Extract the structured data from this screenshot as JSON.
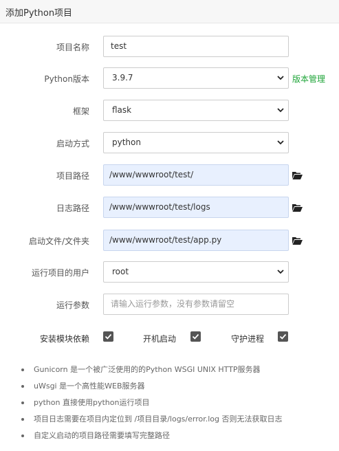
{
  "dialog": {
    "title": "添加Python项目"
  },
  "form": {
    "name": {
      "label": "项目名称",
      "value": "test"
    },
    "version": {
      "label": "Python版本",
      "value": "3.9.7",
      "link": "版本管理"
    },
    "framework": {
      "label": "框架",
      "value": "flask"
    },
    "start_method": {
      "label": "启动方式",
      "value": "python"
    },
    "project_path": {
      "label": "项目路径",
      "value": "/www/wwwroot/test/"
    },
    "log_path": {
      "label": "日志路径",
      "value": "/www/wwwroot/test/logs"
    },
    "start_file": {
      "label": "启动文件/文件夹",
      "value": "/www/wwwroot/test/app.py"
    },
    "run_user": {
      "label": "运行项目的用户",
      "value": "root"
    },
    "run_args": {
      "label": "运行参数",
      "placeholder": "请输入运行参数，没有参数请留空"
    }
  },
  "options": {
    "install_deps": {
      "label": "安装模块依赖",
      "checked": true
    },
    "autostart": {
      "label": "开机启动",
      "checked": true
    },
    "daemon": {
      "label": "守护进程",
      "checked": true
    }
  },
  "notes": [
    "Gunicorn 是一个被广泛使用的的Python WSGI UNIX HTTP服务器",
    "uWsgi 是一个高性能WEB服务器",
    "python 直接使用python运行项目",
    "项目日志需要在项目内定位到 /项目目录/logs/error.log 否则无法获取日志",
    "自定义启动的项目路径需要填写完整路径"
  ],
  "colors": {
    "accent_green": "#20a53a",
    "path_bg": "#e8f0fe",
    "checkbox": "#555555"
  },
  "icons": {
    "folder": "folder-open-icon",
    "dropdown": "chevron-down-icon",
    "check": "check-icon"
  }
}
